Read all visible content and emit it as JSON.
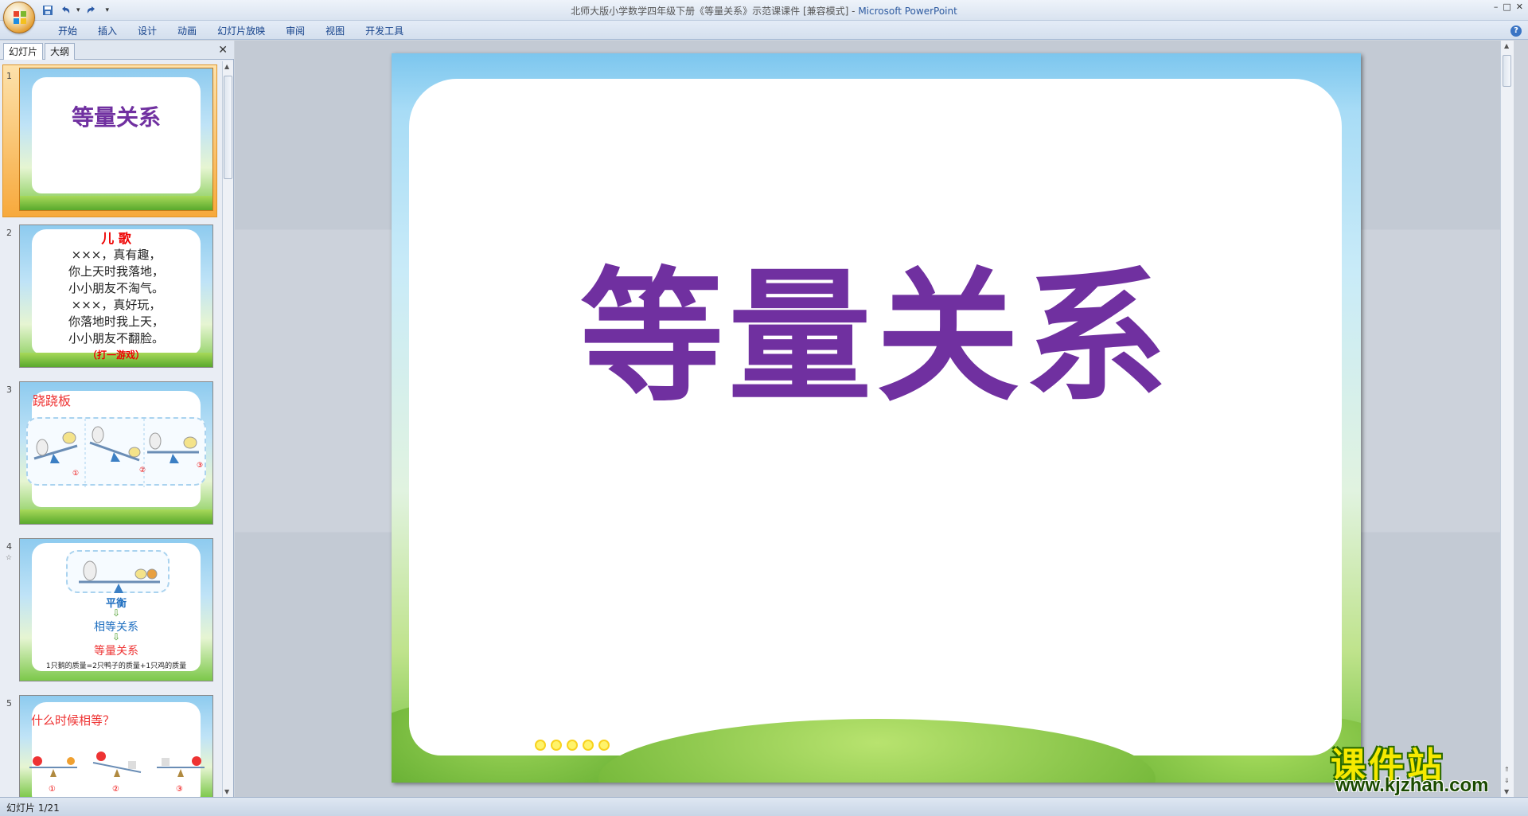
{
  "window": {
    "title_doc": "北师大版小学数学四年级下册《等量关系》示范课课件 [兼容模式] - ",
    "title_app": "Microsoft PowerPoint",
    "controls": [
      "–",
      "□",
      "✕"
    ]
  },
  "ribbon": {
    "tabs": [
      "开始",
      "插入",
      "设计",
      "动画",
      "幻灯片放映",
      "审阅",
      "视图",
      "开发工具"
    ]
  },
  "left_panel": {
    "tab_slides": "幻灯片",
    "tab_outline": "大纲",
    "close": "✕",
    "thumbnails": [
      {
        "num": "1",
        "title": "等量关系"
      },
      {
        "num": "2",
        "head": "儿 歌",
        "lines": [
          "×××，真有趣，",
          "你上天时我落地，",
          "小小朋友不淘气。",
          "×××，真好玩，",
          "你落地时我上天，",
          "小小朋友不翻脸。"
        ],
        "foot": "（打一游戏）"
      },
      {
        "num": "3",
        "title": "跷跷板",
        "marks": [
          "①",
          "②",
          "③"
        ]
      },
      {
        "num": "4",
        "star": "☆",
        "balance": "平衡",
        "equal": "相等关系",
        "equivalence": "等量关系",
        "formula": "1只鹅的质量=2只鸭子的质量+1只鸡的质量"
      },
      {
        "num": "5",
        "title": "什么时候相等？",
        "marks": [
          "①",
          "②",
          "③"
        ]
      }
    ]
  },
  "slide": {
    "title": "等量关系"
  },
  "watermark": {
    "cn": "课件站",
    "url": "www.kjzhan.com"
  },
  "status": {
    "slide_info": "幻灯片 1/21"
  },
  "colors": {
    "title_purple": "#7030a0",
    "accent_orange": "#f7a93c"
  }
}
